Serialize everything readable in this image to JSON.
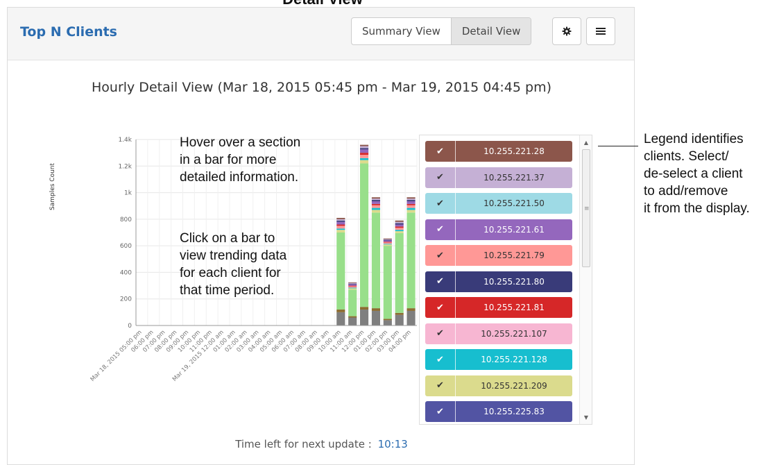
{
  "page_caption": "Detail View",
  "widget": {
    "title": "Top N Clients",
    "views": [
      {
        "label": "Summary View",
        "active": false
      },
      {
        "label": "Detail View",
        "active": true
      }
    ],
    "settings_icon": "gear-icon",
    "menu_icon": "hamburger-menu-icon"
  },
  "chart_title": "Hourly Detail View (Mar 18, 2015 05:45 pm - Mar 19, 2015 04:45 pm)",
  "annotations": {
    "hover": [
      "Hover over a section",
      "in a bar for more",
      "detailed information."
    ],
    "click": [
      "Click on a bar to",
      "view trending data",
      "for each client for",
      "that time period."
    ],
    "legend": [
      "Legend identifies",
      "clients. Select/",
      "de-select a client",
      "to add/remove",
      "it from the display."
    ]
  },
  "legend": {
    "items": [
      {
        "label": "10.255.221.28",
        "color": "#8c564b",
        "text_color": "#ffffff",
        "checked": true
      },
      {
        "label": "10.255.221.37",
        "color": "#c5b0d5",
        "text_color": "#333333",
        "checked": true
      },
      {
        "label": "10.255.221.50",
        "color": "#9edae5",
        "text_color": "#333333",
        "checked": true
      },
      {
        "label": "10.255.221.61",
        "color": "#9467bd",
        "text_color": "#ffffff",
        "checked": true
      },
      {
        "label": "10.255.221.79",
        "color": "#ff9896",
        "text_color": "#333333",
        "checked": true
      },
      {
        "label": "10.255.221.80",
        "color": "#393b79",
        "text_color": "#ffffff",
        "checked": true
      },
      {
        "label": "10.255.221.81",
        "color": "#d62728",
        "text_color": "#ffffff",
        "checked": true
      },
      {
        "label": "10.255.221.107",
        "color": "#f7b6d2",
        "text_color": "#333333",
        "checked": true
      },
      {
        "label": "10.255.221.128",
        "color": "#17becf",
        "text_color": "#ffffff",
        "checked": true
      },
      {
        "label": "10.255.221.209",
        "color": "#dbdb8d",
        "text_color": "#333333",
        "checked": true
      },
      {
        "label": "10.255.225.83",
        "color": "#5254a3",
        "text_color": "#ffffff",
        "checked": true
      }
    ],
    "check_glyph": "✔"
  },
  "footer": {
    "label": "Time left for next update :",
    "timer": "10:13"
  },
  "chart_data": {
    "type": "bar",
    "stacked": true,
    "ylabel": "Samples Count",
    "ylim": [
      0,
      1400
    ],
    "yticks": [
      "0",
      "200",
      "400",
      "600",
      "800",
      "1k",
      "1.2k",
      "1.4k"
    ],
    "ytick_values": [
      0,
      200,
      400,
      600,
      800,
      1000,
      1200,
      1400
    ],
    "grid": true,
    "categories": [
      "Mar 18, 2015 05:00 pm",
      "06:00 pm",
      "07:00 pm",
      "08:00 pm",
      "09:00 pm",
      "10:00 pm",
      "11:00 pm",
      "Mar 19, 2015 12:00 am",
      "01:00 am",
      "02:00 am",
      "03:00 am",
      "04:00 am",
      "05:00 am",
      "06:00 am",
      "07:00 am",
      "08:00 am",
      "09:00 am",
      "10:00 am",
      "11:00 am",
      "12:00 pm",
      "01:00 pm",
      "02:00 pm",
      "03:00 pm",
      "04:00 pm"
    ],
    "series": [
      {
        "color": "#7f7f7f",
        "values": [
          0,
          0,
          0,
          0,
          0,
          0,
          0,
          0,
          0,
          0,
          0,
          0,
          0,
          0,
          0,
          0,
          0,
          100,
          60,
          120,
          110,
          40,
          80,
          110
        ]
      },
      {
        "color": "#8c6d31",
        "values": [
          0,
          0,
          0,
          0,
          0,
          0,
          0,
          0,
          0,
          0,
          0,
          0,
          0,
          0,
          0,
          0,
          0,
          20,
          10,
          20,
          20,
          10,
          15,
          20
        ]
      },
      {
        "color": "#98df8a",
        "values": [
          0,
          0,
          0,
          0,
          0,
          0,
          0,
          0,
          0,
          0,
          0,
          0,
          0,
          0,
          0,
          0,
          0,
          580,
          200,
          1080,
          720,
          550,
          600,
          720
        ]
      },
      {
        "color": "#dbdb8d",
        "values": [
          0,
          0,
          0,
          0,
          0,
          0,
          0,
          0,
          0,
          0,
          0,
          0,
          0,
          0,
          0,
          0,
          0,
          20,
          10,
          25,
          20,
          10,
          15,
          20
        ]
      },
      {
        "color": "#17becf",
        "values": [
          0,
          0,
          0,
          0,
          0,
          0,
          0,
          0,
          0,
          0,
          0,
          0,
          0,
          0,
          0,
          0,
          0,
          10,
          5,
          15,
          15,
          5,
          10,
          15
        ]
      },
      {
        "color": "#ff9896",
        "values": [
          0,
          0,
          0,
          0,
          0,
          0,
          0,
          0,
          0,
          0,
          0,
          0,
          0,
          0,
          0,
          0,
          0,
          20,
          10,
          25,
          20,
          10,
          15,
          20
        ]
      },
      {
        "color": "#d62728",
        "values": [
          0,
          0,
          0,
          0,
          0,
          0,
          0,
          0,
          0,
          0,
          0,
          0,
          0,
          0,
          0,
          0,
          0,
          10,
          5,
          15,
          10,
          5,
          10,
          10
        ]
      },
      {
        "color": "#9467bd",
        "values": [
          0,
          0,
          0,
          0,
          0,
          0,
          0,
          0,
          0,
          0,
          0,
          0,
          0,
          0,
          0,
          0,
          0,
          20,
          10,
          25,
          20,
          10,
          15,
          20
        ]
      },
      {
        "color": "#393b79",
        "values": [
          0,
          0,
          0,
          0,
          0,
          0,
          0,
          0,
          0,
          0,
          0,
          0,
          0,
          0,
          0,
          0,
          0,
          10,
          5,
          10,
          10,
          5,
          10,
          10
        ]
      },
      {
        "color": "#c5b0d5",
        "values": [
          0,
          0,
          0,
          0,
          0,
          0,
          0,
          0,
          0,
          0,
          0,
          0,
          0,
          0,
          0,
          0,
          0,
          10,
          5,
          15,
          10,
          5,
          10,
          10
        ]
      },
      {
        "color": "#8c564b",
        "values": [
          0,
          0,
          0,
          0,
          0,
          0,
          0,
          0,
          0,
          0,
          0,
          0,
          0,
          0,
          0,
          0,
          0,
          10,
          5,
          10,
          10,
          5,
          10,
          10
        ]
      }
    ]
  }
}
